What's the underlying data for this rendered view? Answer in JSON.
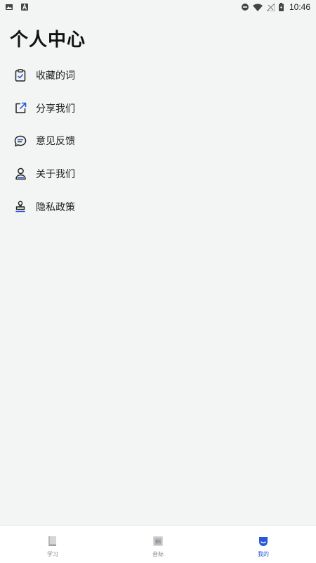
{
  "status_bar": {
    "time": "10:46"
  },
  "page": {
    "title": "个人中心"
  },
  "menu": [
    {
      "label": "收藏的词",
      "icon": "clipboard-check-icon"
    },
    {
      "label": "分享我们",
      "icon": "share-external-icon"
    },
    {
      "label": "意见反馈",
      "icon": "feedback-bubble-icon"
    },
    {
      "label": "关于我们",
      "icon": "person-icon"
    },
    {
      "label": "隐私政策",
      "icon": "stamp-icon"
    }
  ],
  "tabs": [
    {
      "label": "学习",
      "icon": "book-icon",
      "active": false
    },
    {
      "label": "音标",
      "icon": "phonetic-card-icon",
      "active": false
    },
    {
      "label": "我的",
      "icon": "profile-icon",
      "active": true
    }
  ],
  "colors": {
    "accent": "#2a56d9",
    "background": "#f3f5f4",
    "tab_inactive": "#888888"
  }
}
